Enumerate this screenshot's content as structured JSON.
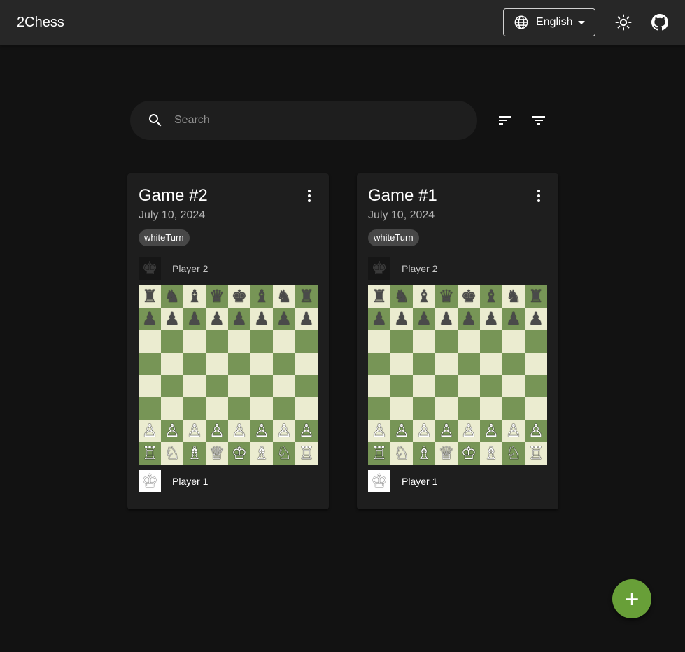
{
  "app": {
    "title": "2Chess"
  },
  "header": {
    "language": {
      "value": "English",
      "icon": "globe-icon"
    },
    "theme_icon": "sun-icon",
    "github_icon": "github-icon"
  },
  "search": {
    "placeholder": "Search",
    "value": "",
    "icon": "search-icon"
  },
  "toolbar": {
    "sort_icon": "sort-icon",
    "filter_icon": "filter-icon"
  },
  "colors": {
    "accent": "#689f38",
    "board_light": "#ebecd0",
    "board_dark": "#779556",
    "card_bg": "#1e1e1e",
    "page_bg": "#121212"
  },
  "pieces": {
    "bk": "♚",
    "bq": "♛",
    "br": "♜",
    "bb": "♝",
    "bn": "♞",
    "bp": "♟",
    "wk": "♔",
    "wq": "♕",
    "wr": "♖",
    "wb": "♗",
    "wn": "♘",
    "wp": "♙"
  },
  "games": [
    {
      "title": "Game #2",
      "date": "July 10, 2024",
      "status": "whiteTurn",
      "top_player": {
        "name": "Player 2",
        "color": "black"
      },
      "bottom_player": {
        "name": "Player 1",
        "color": "white"
      },
      "board": [
        [
          "br",
          "bn",
          "bb",
          "bq",
          "bk",
          "bb",
          "bn",
          "br"
        ],
        [
          "bp",
          "bp",
          "bp",
          "bp",
          "bp",
          "bp",
          "bp",
          "bp"
        ],
        [
          "",
          "",
          "",
          "",
          "",
          "",
          "",
          ""
        ],
        [
          "",
          "",
          "",
          "",
          "",
          "",
          "",
          ""
        ],
        [
          "",
          "",
          "",
          "",
          "",
          "",
          "",
          ""
        ],
        [
          "",
          "",
          "",
          "",
          "",
          "",
          "",
          ""
        ],
        [
          "wp",
          "wp",
          "wp",
          "wp",
          "wp",
          "wp",
          "wp",
          "wp"
        ],
        [
          "wr",
          "wn",
          "wb",
          "wq",
          "wk",
          "wb",
          "wn",
          "wr"
        ]
      ]
    },
    {
      "title": "Game #1",
      "date": "July 10, 2024",
      "status": "whiteTurn",
      "top_player": {
        "name": "Player 2",
        "color": "black"
      },
      "bottom_player": {
        "name": "Player 1",
        "color": "white"
      },
      "board": [
        [
          "br",
          "bn",
          "bb",
          "bq",
          "bk",
          "bb",
          "bn",
          "br"
        ],
        [
          "bp",
          "bp",
          "bp",
          "bp",
          "bp",
          "bp",
          "bp",
          "bp"
        ],
        [
          "",
          "",
          "",
          "",
          "",
          "",
          "",
          ""
        ],
        [
          "",
          "",
          "",
          "",
          "",
          "",
          "",
          ""
        ],
        [
          "",
          "",
          "",
          "",
          "",
          "",
          "",
          ""
        ],
        [
          "",
          "",
          "",
          "",
          "",
          "",
          "",
          ""
        ],
        [
          "wp",
          "wp",
          "wp",
          "wp",
          "wp",
          "wp",
          "wp",
          "wp"
        ],
        [
          "wr",
          "wn",
          "wb",
          "wq",
          "wk",
          "wb",
          "wn",
          "wr"
        ]
      ]
    }
  ],
  "fab": {
    "label": "+",
    "icon": "plus-icon"
  }
}
